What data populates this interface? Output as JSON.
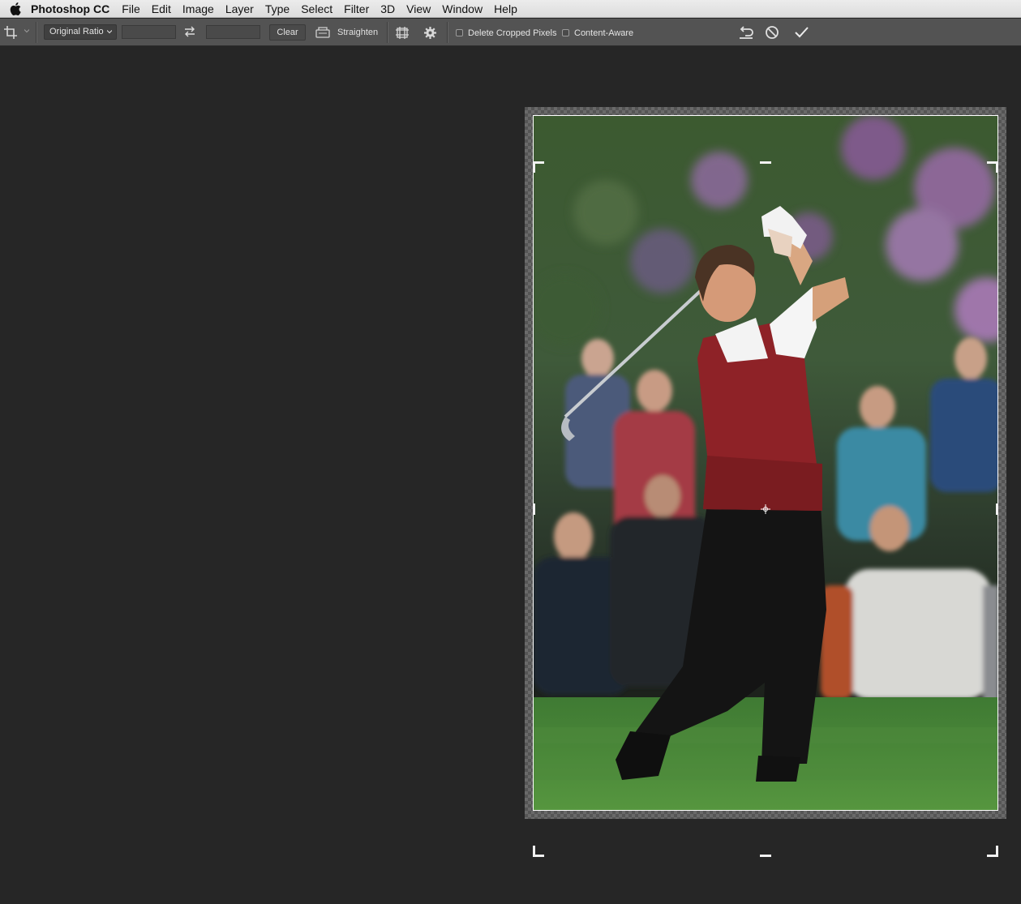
{
  "menubar": {
    "app_name": "Photoshop CC",
    "items": [
      "File",
      "Edit",
      "Image",
      "Layer",
      "Type",
      "Select",
      "Filter",
      "3D",
      "View",
      "Window",
      "Help"
    ]
  },
  "options_bar": {
    "ratio_value": "Original Ratio",
    "width_value": "",
    "height_value": "",
    "clear_label": "Clear",
    "straighten_label": "Straighten",
    "delete_cropped_label": "Delete Cropped Pixels",
    "delete_cropped_checked": false,
    "content_aware_label": "Content-Aware",
    "content_aware_checked": false
  },
  "icons": {
    "apple": "apple-icon",
    "tool": "crop-tool-icon",
    "swap": "swap-icon",
    "straighten": "level-icon",
    "overlay": "grid-overlay-icon",
    "settings": "gear-icon",
    "reset": "reset-icon",
    "cancel": "cancel-icon",
    "commit": "checkmark-icon"
  },
  "colors": {
    "menubar_bg": "#e0e0e0",
    "optionsbar_bg": "#535353",
    "canvas_bg": "#262626",
    "crop_frame": "#ffffff"
  }
}
